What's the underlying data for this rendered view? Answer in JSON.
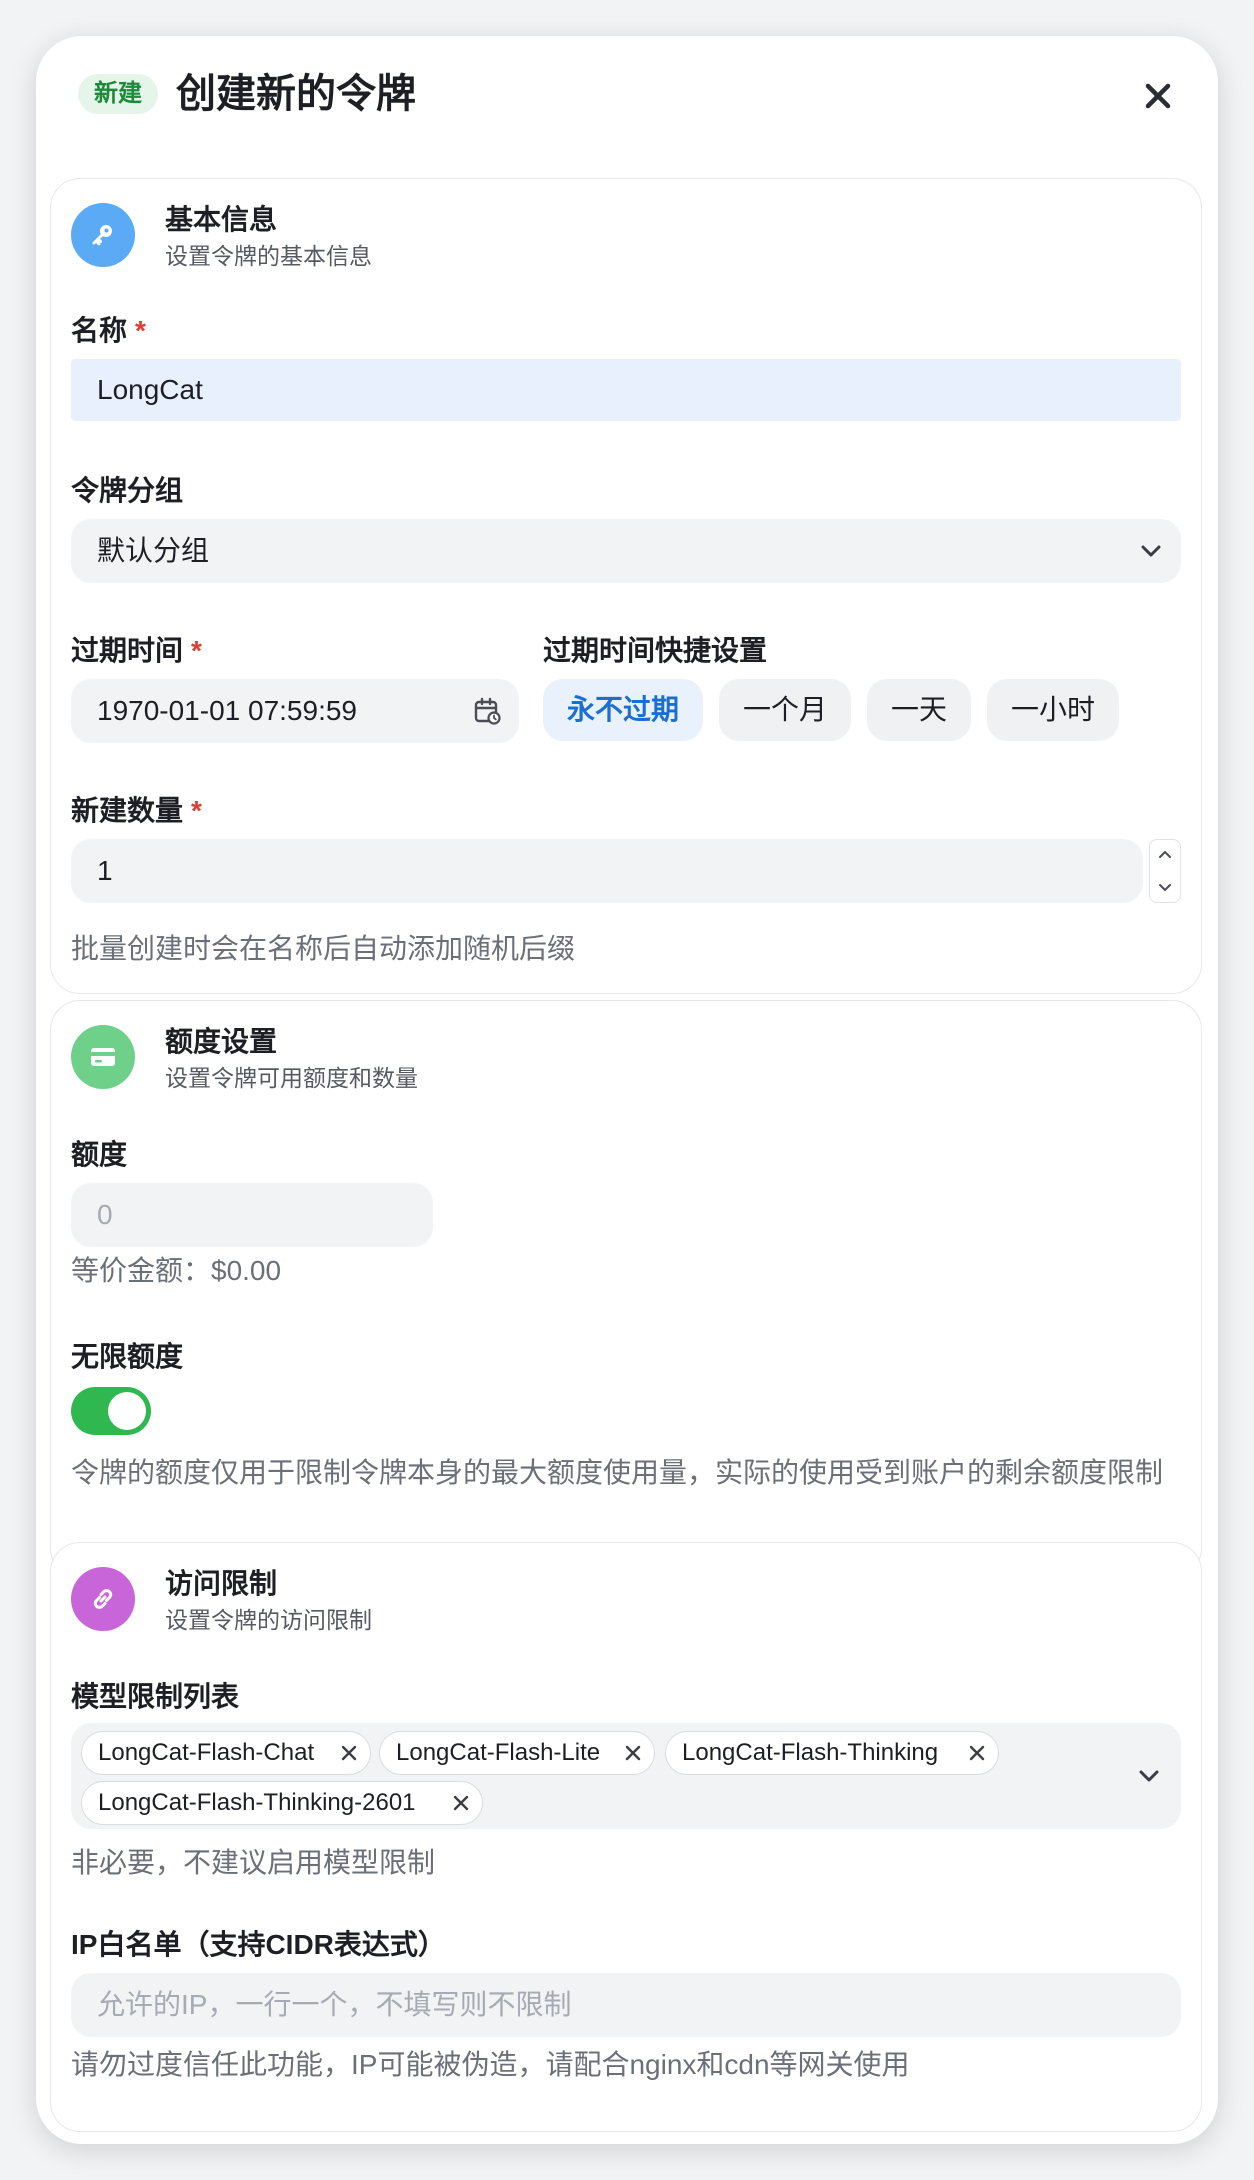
{
  "header": {
    "badge": "新建",
    "title": "创建新的令牌"
  },
  "basic": {
    "title": "基本信息",
    "subtitle": "设置令牌的基本信息",
    "name_label": "名称",
    "name_value": "LongCat",
    "group_label": "令牌分组",
    "group_value": "默认分组",
    "expire_label": "过期时间",
    "expire_value": "1970-01-01 07:59:59",
    "quick_label": "过期时间快捷设置",
    "quick_buttons": [
      "永不过期",
      "一个月",
      "一天",
      "一小时"
    ],
    "count_label": "新建数量",
    "count_value": "1",
    "count_hint": "批量创建时会在名称后自动添加随机后缀",
    "required_mark": "*"
  },
  "quota": {
    "title": "额度设置",
    "subtitle": "设置令牌可用额度和数量",
    "quota_label": "额度",
    "quota_placeholder": "0",
    "equiv_text": "等价金额：$0.00",
    "unlimited_label": "无限额度",
    "unlimited_on": true,
    "unlimited_hint": "令牌的额度仅用于限制令牌本身的最大额度使用量，实际的使用受到账户的剩余额度限制"
  },
  "access": {
    "title": "访问限制",
    "subtitle": "设置令牌的访问限制",
    "models_label": "模型限制列表",
    "models": [
      "LongCat-Flash-Chat",
      "LongCat-Flash-Lite",
      "LongCat-Flash-Thinking",
      "LongCat-Flash-Thinking-2601"
    ],
    "models_hint": "非必要，不建议启用模型限制",
    "ip_label": "IP白名单（支持CIDR表达式）",
    "ip_placeholder": "允许的IP，一行一个，不填写则不限制",
    "ip_hint": "请勿过度信任此功能，IP可能被伪造，请配合nginx和cdn等网关使用"
  },
  "colors": {
    "key_icon_bg": "#5aaaf5",
    "card_icon_bg": "#6fd08a",
    "link_icon_bg": "#c865d9",
    "toggle_on": "#2fb84f",
    "active_blue": "#1b6fd1",
    "required_red": "#e03c31"
  },
  "icons": {
    "close": "close-icon",
    "basic": "key-icon",
    "quota": "credit-card-icon",
    "access": "link-icon",
    "select": "chevron-down-icon",
    "date": "calendar-icon",
    "stepper": "stepper-icon",
    "tag_remove": "close-small-icon"
  }
}
